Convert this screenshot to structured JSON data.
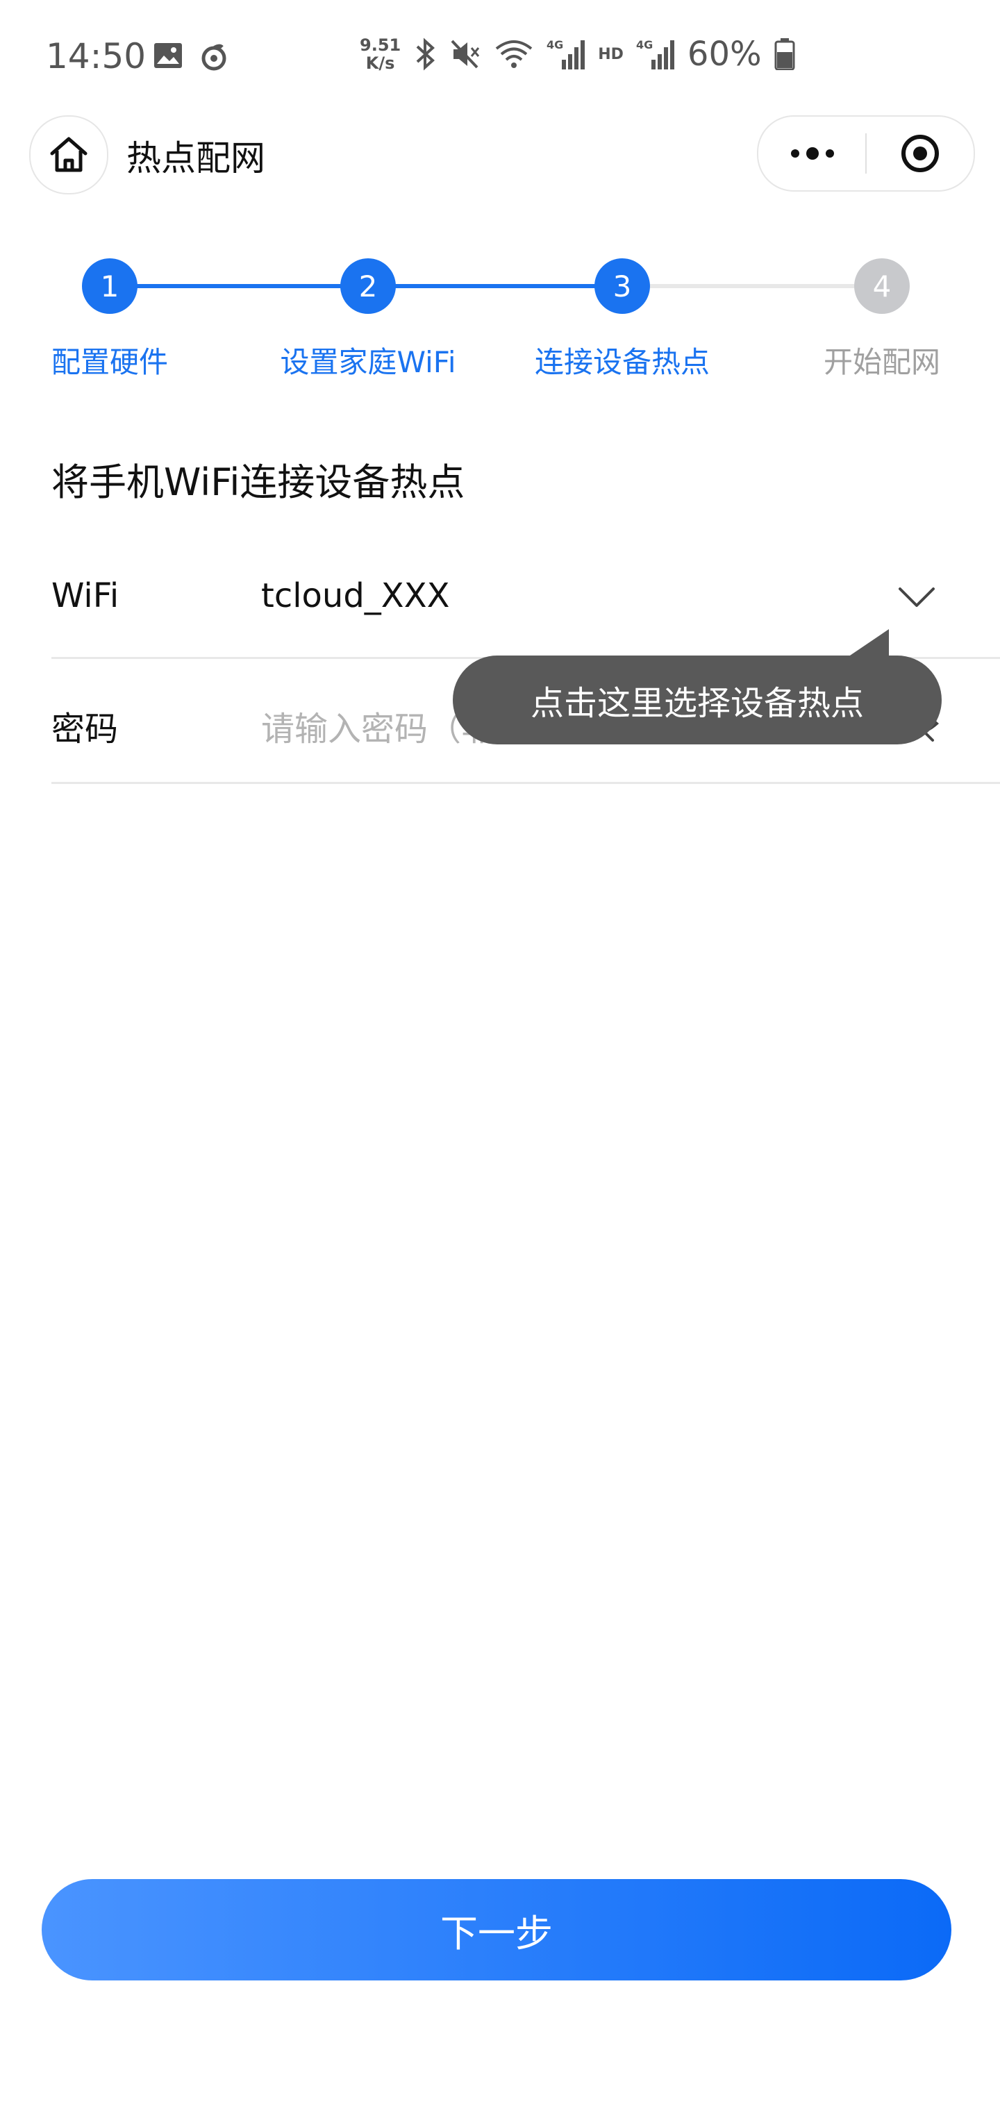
{
  "status_bar": {
    "time": "14:50",
    "net_speed_top": "9.51",
    "net_speed_bottom": "K/s",
    "hd_label": "HD",
    "battery_percent": "60%"
  },
  "nav": {
    "title": "热点配网"
  },
  "steps": [
    {
      "number": "1",
      "label": "配置硬件",
      "state": "done"
    },
    {
      "number": "2",
      "label": "设置家庭WiFi",
      "state": "done"
    },
    {
      "number": "3",
      "label": "连接设备热点",
      "state": "active"
    },
    {
      "number": "4",
      "label": "开始配网",
      "state": "pending"
    }
  ],
  "form": {
    "title": "将手机WiFi连接设备热点",
    "wifi_label": "WiFi",
    "wifi_value": "tcloud_XXX",
    "password_label": "密码",
    "password_placeholder": "请输入密码（非必填）"
  },
  "tooltip": {
    "text": "点击这里选择设备热点"
  },
  "next_button": {
    "label": "下一步"
  },
  "colors": {
    "accent": "#1a73f0",
    "inactive": "#c8c9cc",
    "tooltip_bg": "#595959"
  }
}
